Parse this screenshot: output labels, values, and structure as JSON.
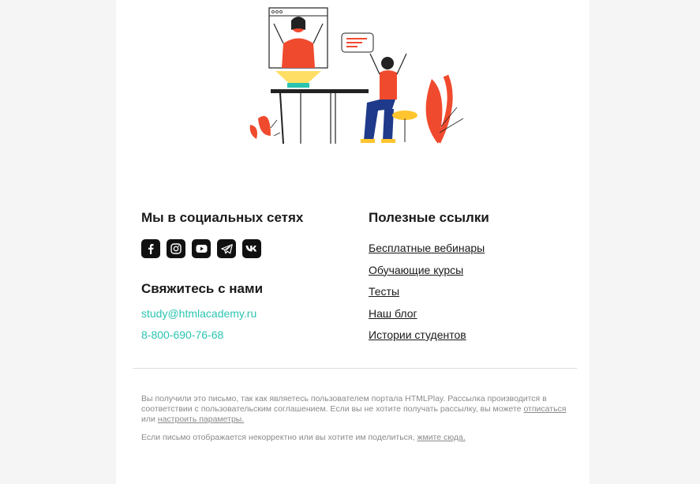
{
  "social": {
    "title": "Мы в социальных сетях",
    "icons": [
      "facebook-icon",
      "instagram-icon",
      "youtube-icon",
      "telegram-icon",
      "vk-icon"
    ]
  },
  "contact": {
    "title": "Свяжитесь с нами",
    "email": "study@htmlacademy.ru",
    "phone": "8-800-690-76-68",
    "accent_color": "#2bc4b0"
  },
  "links": {
    "title": "Полезные ссылки",
    "items": [
      "Бесплатные вебинары",
      "Обучающие курсы",
      "Тесты",
      "Наш блог",
      "Истории студентов"
    ]
  },
  "legal": {
    "text1": "Вы получили это письмо, так как являетесь пользователем портала HTMLPlay. Рассылка производится в соответствии с пользовательским соглашением. Если вы не хотите получать рассылку, вы можете",
    "unsubscribe": "отписаться",
    "or": "или",
    "settings": "настроить параметры.",
    "text2": "Если письмо отображается некорректно или вы хотите им поделиться,",
    "click_here": "жмите сюда."
  }
}
